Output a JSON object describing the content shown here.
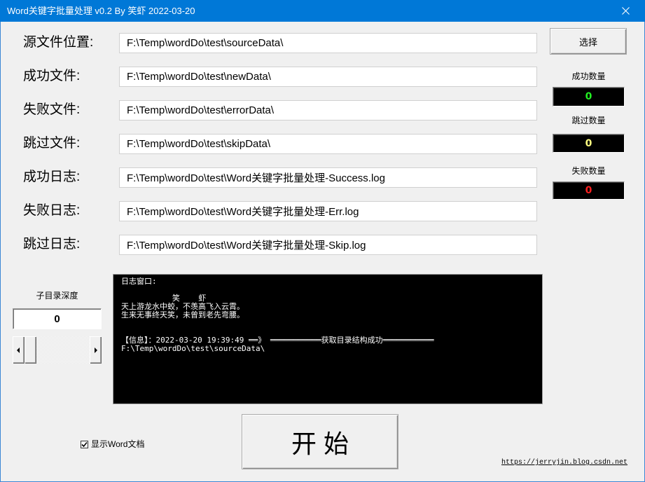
{
  "window": {
    "title": "Word关键字批量处理 v0.2 By 笑虾 2022-03-20",
    "close_icon": "close-icon"
  },
  "paths": [
    {
      "label": "源文件位置:",
      "value": "F:\\Temp\\wordDo\\test\\sourceData\\"
    },
    {
      "label": "成功文件:",
      "value": "F:\\Temp\\wordDo\\test\\newData\\"
    },
    {
      "label": "失败文件:",
      "value": "F:\\Temp\\wordDo\\test\\errorData\\"
    },
    {
      "label": "跳过文件:",
      "value": "F:\\Temp\\wordDo\\test\\skipData\\"
    },
    {
      "label": "成功日志:",
      "value": "F:\\Temp\\wordDo\\test\\Word关键字批量处理-Success.log"
    },
    {
      "label": "失败日志:",
      "value": "F:\\Temp\\wordDo\\test\\Word关键字批量处理-Err.log"
    },
    {
      "label": "跳过日志:",
      "value": "F:\\Temp\\wordDo\\test\\Word关键字批量处理-Skip.log"
    }
  ],
  "select_button": {
    "label": "选择"
  },
  "counters": [
    {
      "label": "成功数量",
      "value": "0",
      "color": "#22ee22"
    },
    {
      "label": "跳过数量",
      "value": "0",
      "color": "#ffff80"
    },
    {
      "label": "失败数量",
      "value": "0",
      "color": "#ff2020"
    }
  ],
  "depth": {
    "label": "子目录深度",
    "value": "0",
    "scroll_fraction": 0,
    "left_arrow_icon": "arrow-left-icon",
    "right_arrow_icon": "arrow-right-icon"
  },
  "log": {
    "lines": [
      "日志窗口:",
      "           笑    虾",
      "天上游龙水中蛟，不羡高飞入云霄。",
      "生来无事终天笑，未曾到老先弯腰。",
      "【信息】：2022-03-20 19:39:49 ══》 ═══════════获取目录结构成功═══════════",
      "F:\\Temp\\wordDo\\test\\sourceData\\"
    ]
  },
  "start_button": {
    "label": "开 始"
  },
  "show_word": {
    "label": "显示Word文档",
    "checked": true,
    "check_icon": "check-icon"
  },
  "link": {
    "text": "https://jerryjin.blog.csdn.net"
  },
  "colors": {
    "titlebar": "#0078d7",
    "window_background": "#f0f0f0",
    "log_background": "#000000",
    "log_text": "#ffffff"
  }
}
